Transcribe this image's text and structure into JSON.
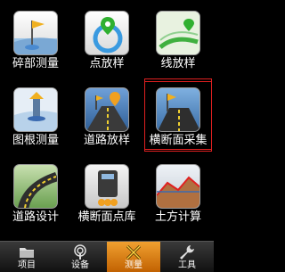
{
  "tiles": [
    {
      "label": "碎部测量",
      "icon": "survey-flag-icon"
    },
    {
      "label": "点放样",
      "icon": "point-stakeout-icon"
    },
    {
      "label": "线放样",
      "icon": "line-stakeout-icon"
    },
    {
      "label": "图根测量",
      "icon": "control-survey-icon"
    },
    {
      "label": "道路放样",
      "icon": "road-stakeout-icon"
    },
    {
      "label": "横断面采集",
      "icon": "cross-section-collect-icon"
    },
    {
      "label": "道路设计",
      "icon": "road-design-icon"
    },
    {
      "label": "横断面点库",
      "icon": "cross-section-library-icon"
    },
    {
      "label": "土方计算",
      "icon": "earthwork-calc-icon"
    }
  ],
  "selected_tile": "横断面采集",
  "tabs": [
    {
      "label": "项目",
      "icon": "folder-icon"
    },
    {
      "label": "设备",
      "icon": "antenna-icon"
    },
    {
      "label": "测量",
      "icon": "tools-cross-icon"
    },
    {
      "label": "工具",
      "icon": "wrench-icon"
    }
  ],
  "active_tab": "测量",
  "colors": {
    "highlight": "#e02020",
    "active_tab": "#e08a20"
  }
}
